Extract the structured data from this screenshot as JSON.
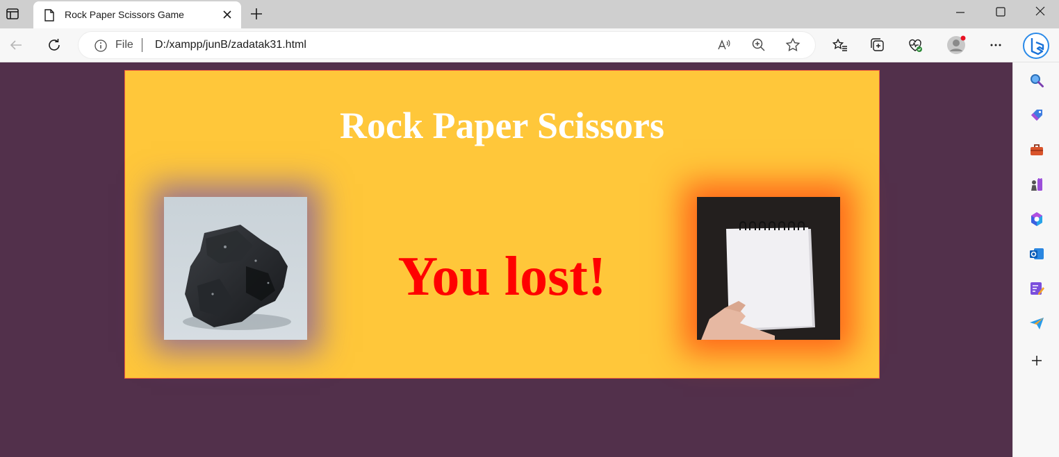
{
  "browser": {
    "tab_title": "Rock Paper Scissors Game",
    "address_scheme": "File",
    "address_url": "D:/xampp/junB/zadatak31.html"
  },
  "page": {
    "title": "Rock Paper Scissors",
    "result": "You lost!",
    "player_choice": "rock",
    "computer_choice": "paper"
  },
  "colors": {
    "page_background": "#52304b",
    "game_background": "#ffc73a",
    "title_color": "#ffffff",
    "result_color": "#ff0000",
    "player_glow": "#6446be",
    "computer_glow": "#ff5514"
  },
  "icons": {
    "tab": [
      "tab-actions-icon",
      "page-icon",
      "close-icon",
      "new-tab-icon"
    ],
    "window": [
      "minimize-icon",
      "maximize-icon",
      "close-window-icon"
    ],
    "toolbar": [
      "back-icon",
      "refresh-icon",
      "info-icon",
      "read-aloud-icon",
      "zoom-icon",
      "favorite-star-icon",
      "favorites-icon",
      "collections-icon",
      "browser-essentials-icon",
      "profile-icon",
      "more-icon",
      "bing-copilot-icon"
    ],
    "sidebar": [
      "search-icon",
      "shopping-icon",
      "tools-icon",
      "games-icon",
      "microsoft-365-icon",
      "outlook-icon",
      "designer-icon",
      "send-icon",
      "add-icon"
    ]
  }
}
